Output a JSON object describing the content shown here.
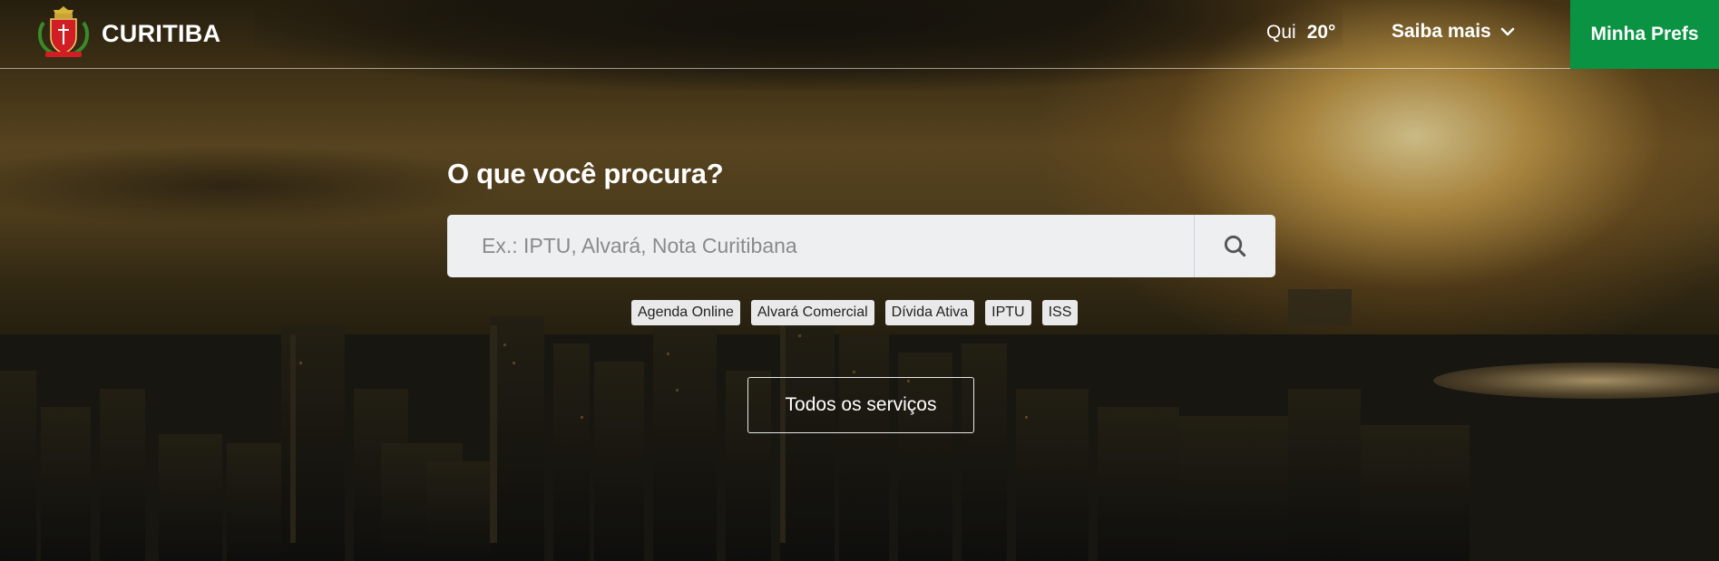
{
  "header": {
    "brand": "CURITIBA",
    "weather_day": "Qui",
    "weather_temp": "20°",
    "saiba_label": "Saiba mais",
    "minha_label": "Minha Prefs"
  },
  "search": {
    "question": "O que você procura?",
    "placeholder": "Ex.: IPTU, Alvará, Nota Curitibana"
  },
  "quick_tags": [
    "Agenda Online",
    "Alvará Comercial",
    "Dívida Ativa",
    "IPTU",
    "ISS"
  ],
  "all_services_label": "Todos os serviços",
  "colors": {
    "accent_green": "#0a9342",
    "search_bg": "#eeeff1",
    "tag_bg": "#e9e9e9"
  },
  "icons": {
    "logo": "coat-of-arms-icon",
    "dropdown": "chevron-down-icon",
    "search": "search-icon"
  }
}
